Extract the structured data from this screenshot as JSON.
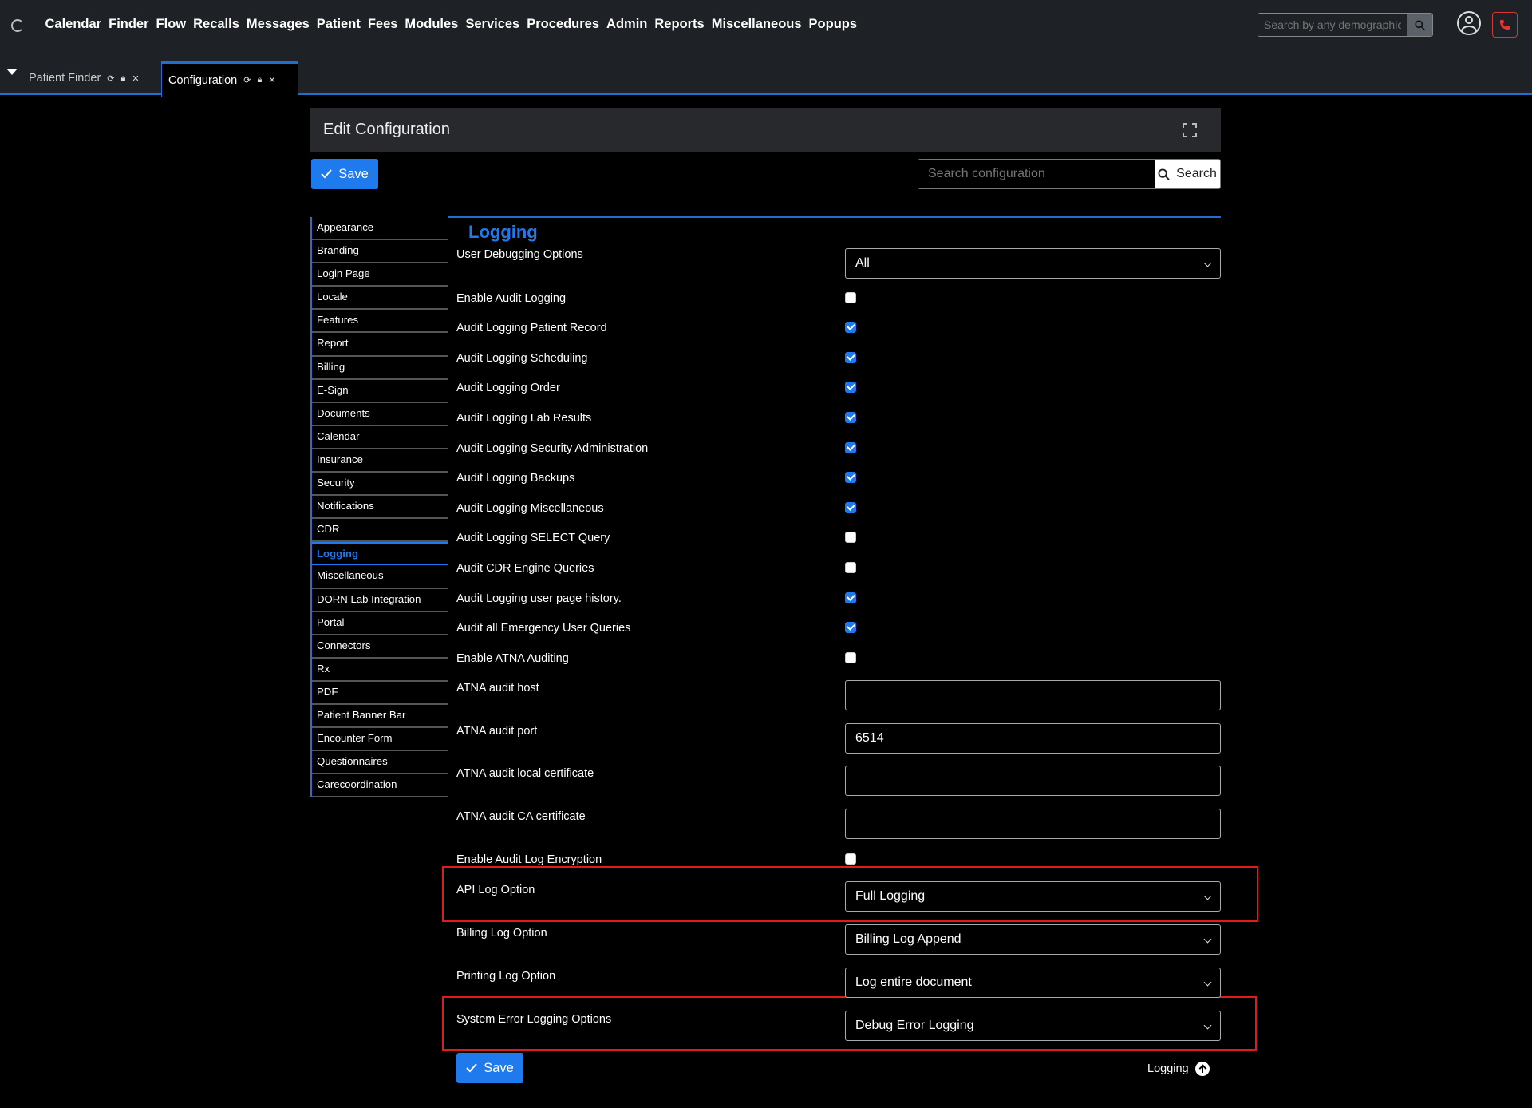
{
  "nav": {
    "items": [
      "Calendar",
      "Finder",
      "Flow",
      "Recalls",
      "Messages",
      "Patient",
      "Fees",
      "Modules",
      "Services",
      "Procedures",
      "Admin",
      "Reports",
      "Miscellaneous",
      "Popups"
    ],
    "search_placeholder": "Search by any demographics"
  },
  "tabs": [
    {
      "label": "Patient Finder",
      "active": false
    },
    {
      "label": "Configuration",
      "active": true
    }
  ],
  "panel": {
    "title": "Edit Configuration",
    "save_label": "Save",
    "search_placeholder": "Search configuration",
    "search_button": "Search"
  },
  "sidebar": {
    "items": [
      "Appearance",
      "Branding",
      "Login Page",
      "Locale",
      "Features",
      "Report",
      "Billing",
      "E-Sign",
      "Documents",
      "Calendar",
      "Insurance",
      "Security",
      "Notifications",
      "CDR",
      "Logging",
      "Miscellaneous",
      "DORN Lab Integration",
      "Portal",
      "Connectors",
      "Rx",
      "PDF",
      "Patient Banner Bar",
      "Encounter Form",
      "Questionnaires",
      "Carecoordination"
    ],
    "active": "Logging"
  },
  "section": {
    "title": "Logging",
    "rows": [
      {
        "label": "User Debugging Options",
        "type": "select",
        "value": "All"
      },
      {
        "label": "Enable Audit Logging",
        "type": "checkbox",
        "checked": false
      },
      {
        "label": "Audit Logging Patient Record",
        "type": "checkbox",
        "checked": true
      },
      {
        "label": "Audit Logging Scheduling",
        "type": "checkbox",
        "checked": true
      },
      {
        "label": "Audit Logging Order",
        "type": "checkbox",
        "checked": true
      },
      {
        "label": "Audit Logging Lab Results",
        "type": "checkbox",
        "checked": true
      },
      {
        "label": "Audit Logging Security Administration",
        "type": "checkbox",
        "checked": true
      },
      {
        "label": "Audit Logging Backups",
        "type": "checkbox",
        "checked": true
      },
      {
        "label": "Audit Logging Miscellaneous",
        "type": "checkbox",
        "checked": true
      },
      {
        "label": "Audit Logging SELECT Query",
        "type": "checkbox",
        "checked": false
      },
      {
        "label": "Audit CDR Engine Queries",
        "type": "checkbox",
        "checked": false
      },
      {
        "label": "Audit Logging user page history.",
        "type": "checkbox",
        "checked": true
      },
      {
        "label": "Audit all Emergency User Queries",
        "type": "checkbox",
        "checked": true
      },
      {
        "label": "Enable ATNA Auditing",
        "type": "checkbox",
        "checked": false
      },
      {
        "label": "ATNA audit host",
        "type": "text",
        "value": ""
      },
      {
        "label": "ATNA audit port",
        "type": "text",
        "value": "6514"
      },
      {
        "label": "ATNA audit local certificate",
        "type": "text",
        "value": ""
      },
      {
        "label": "ATNA audit CA certificate",
        "type": "text",
        "value": ""
      },
      {
        "label": "Enable Audit Log Encryption",
        "type": "checkbox",
        "checked": false
      },
      {
        "label": "API Log Option",
        "type": "select",
        "value": "Full Logging"
      },
      {
        "label": "Billing Log Option",
        "type": "select",
        "value": "Billing Log Append"
      },
      {
        "label": "Printing Log Option",
        "type": "select",
        "value": "Log entire document"
      },
      {
        "label": "System Error Logging Options",
        "type": "select",
        "value": "Debug Error Logging"
      }
    ]
  },
  "footer": {
    "save_label": "Save",
    "top_link": "Logging"
  },
  "colors": {
    "accent": "#1f7aee",
    "highlight": "#e01b1b",
    "topbar": "#1e2125"
  }
}
